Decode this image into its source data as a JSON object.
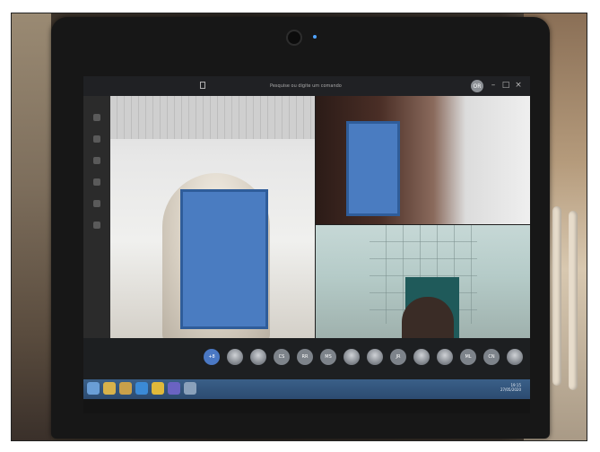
{
  "app": {
    "search_placeholder": "Pesquise ou digite um comando",
    "user_initials": "OR",
    "window_controls": [
      "–",
      "□",
      "×"
    ]
  },
  "participants": [
    {
      "label": "+8",
      "kind": "plus"
    },
    {
      "label": "",
      "kind": "photo"
    },
    {
      "label": "",
      "kind": "photo"
    },
    {
      "label": "CS",
      "kind": "initials"
    },
    {
      "label": "RR",
      "kind": "initials"
    },
    {
      "label": "MS",
      "kind": "initials"
    },
    {
      "label": "",
      "kind": "photo"
    },
    {
      "label": "",
      "kind": "photo"
    },
    {
      "label": "JR",
      "kind": "initials"
    },
    {
      "label": "",
      "kind": "photo"
    },
    {
      "label": "",
      "kind": "photo"
    },
    {
      "label": "ML",
      "kind": "initials"
    },
    {
      "label": "CN",
      "kind": "initials"
    },
    {
      "label": "",
      "kind": "photo"
    }
  ],
  "taskbar": {
    "icons": [
      "windows-start-icon",
      "file-explorer-icon",
      "folder-icon",
      "edge-icon",
      "chrome-icon",
      "teams-icon",
      "other-icon"
    ],
    "time": "19:15",
    "date": "27/05/2020"
  },
  "colors": {
    "redaction": "#4a7cc1",
    "taskbar": "#2c4b70"
  }
}
